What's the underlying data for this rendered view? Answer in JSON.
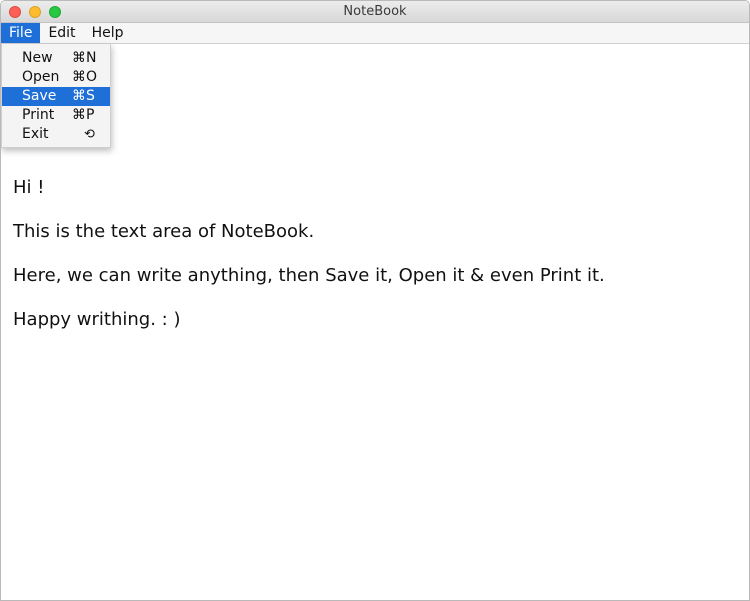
{
  "window": {
    "title": "NoteBook"
  },
  "menubar": {
    "file": "File",
    "edit": "Edit",
    "help": "Help"
  },
  "file_menu": {
    "items": [
      {
        "label": "New",
        "shortcut": "⌘N"
      },
      {
        "label": "Open",
        "shortcut": "⌘O"
      },
      {
        "label": "Save",
        "shortcut": "⌘S",
        "selected": true
      },
      {
        "label": "Print",
        "shortcut": "⌘P"
      },
      {
        "label": "Exit",
        "shortcut_icon": "exit-icon",
        "shortcut": "⟲"
      }
    ]
  },
  "document": {
    "lines": [
      "Hi !",
      "This is the text area of NoteBook.",
      "Here, we can write anything, then Save it, Open it & even Print it.",
      "Happy writhing. : )"
    ]
  },
  "colors": {
    "accent": "#1e6fd8",
    "close": "#fc5f57",
    "minimize": "#fdbc2e",
    "maximize": "#28c840"
  }
}
